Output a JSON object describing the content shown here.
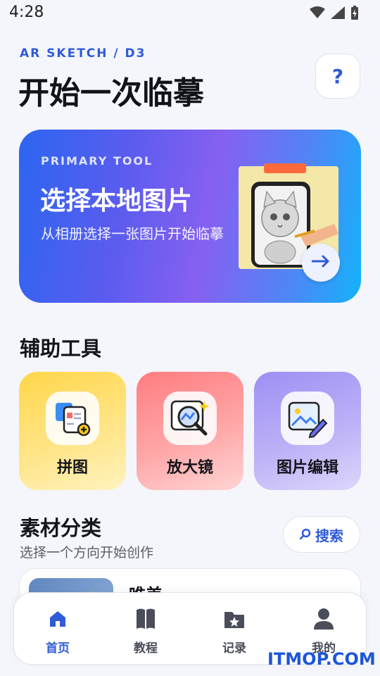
{
  "status": {
    "time": "4:28",
    "wifi_icon": "wifi-icon",
    "signal_icon": "signal-icon",
    "battery_icon": "battery-charging-icon"
  },
  "header": {
    "app_tag": "AR SKETCH / D3",
    "title": "开始一次临摹",
    "help_label": "?"
  },
  "hero": {
    "eyebrow": "PRIMARY TOOL",
    "title": "选择本地图片",
    "subtitle": "从相册选择一张图片开始临摹",
    "art_icon": "cat-sketch-phone-illustration",
    "arrow_icon": "arrow-right-icon"
  },
  "tools": {
    "title": "辅助工具",
    "items": [
      {
        "label": "拼图",
        "icon": "puzzle-collage-icon"
      },
      {
        "label": "放大镜",
        "icon": "magnifier-icon"
      },
      {
        "label": "图片编辑",
        "icon": "image-edit-icon"
      }
    ]
  },
  "materials": {
    "title": "素材分类",
    "subtitle": "选择一个方向开始创作",
    "search_label": "搜索",
    "search_icon": "search-icon",
    "first_category": "唯美"
  },
  "nav": {
    "items": [
      {
        "label": "首页",
        "icon": "home-icon",
        "active": true
      },
      {
        "label": "教程",
        "icon": "book-icon",
        "active": false
      },
      {
        "label": "记录",
        "icon": "folder-star-icon",
        "active": false
      },
      {
        "label": "我的",
        "icon": "person-icon",
        "active": false
      }
    ]
  },
  "colors": {
    "accent": "#2f5bd9",
    "background": "#f5f6fb"
  },
  "watermark": "ITMOP.COM"
}
